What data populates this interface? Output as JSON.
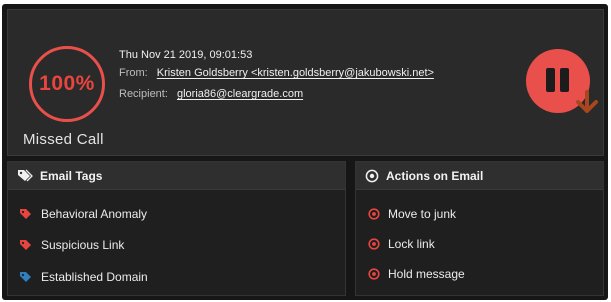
{
  "header": {
    "progress": "100%",
    "status": "Missed Call",
    "timestamp": "Thu Nov 21 2019, 09:01:53",
    "from_label": "From:",
    "from_value": "Kristen Goldsberry <kristen.goldsberry@jakubowski.net>",
    "recipient_label": "Recipient:",
    "recipient_value": "gloria86@cleargrade.com"
  },
  "tags_panel": {
    "title": "Email Tags",
    "items": [
      {
        "label": "Behavioral Anomaly",
        "color": "#e9453f"
      },
      {
        "label": "Suspicious Link",
        "color": "#e9453f"
      },
      {
        "label": "Established Domain",
        "color": "#2f7fc1"
      }
    ]
  },
  "actions_panel": {
    "title": "Actions on Email",
    "items": [
      {
        "label": "Move to junk"
      },
      {
        "label": "Lock link"
      },
      {
        "label": "Hold message"
      }
    ]
  },
  "colors": {
    "accent": "#e9504b",
    "tag_blue": "#2f7fc1",
    "arrow": "#a8471f"
  }
}
